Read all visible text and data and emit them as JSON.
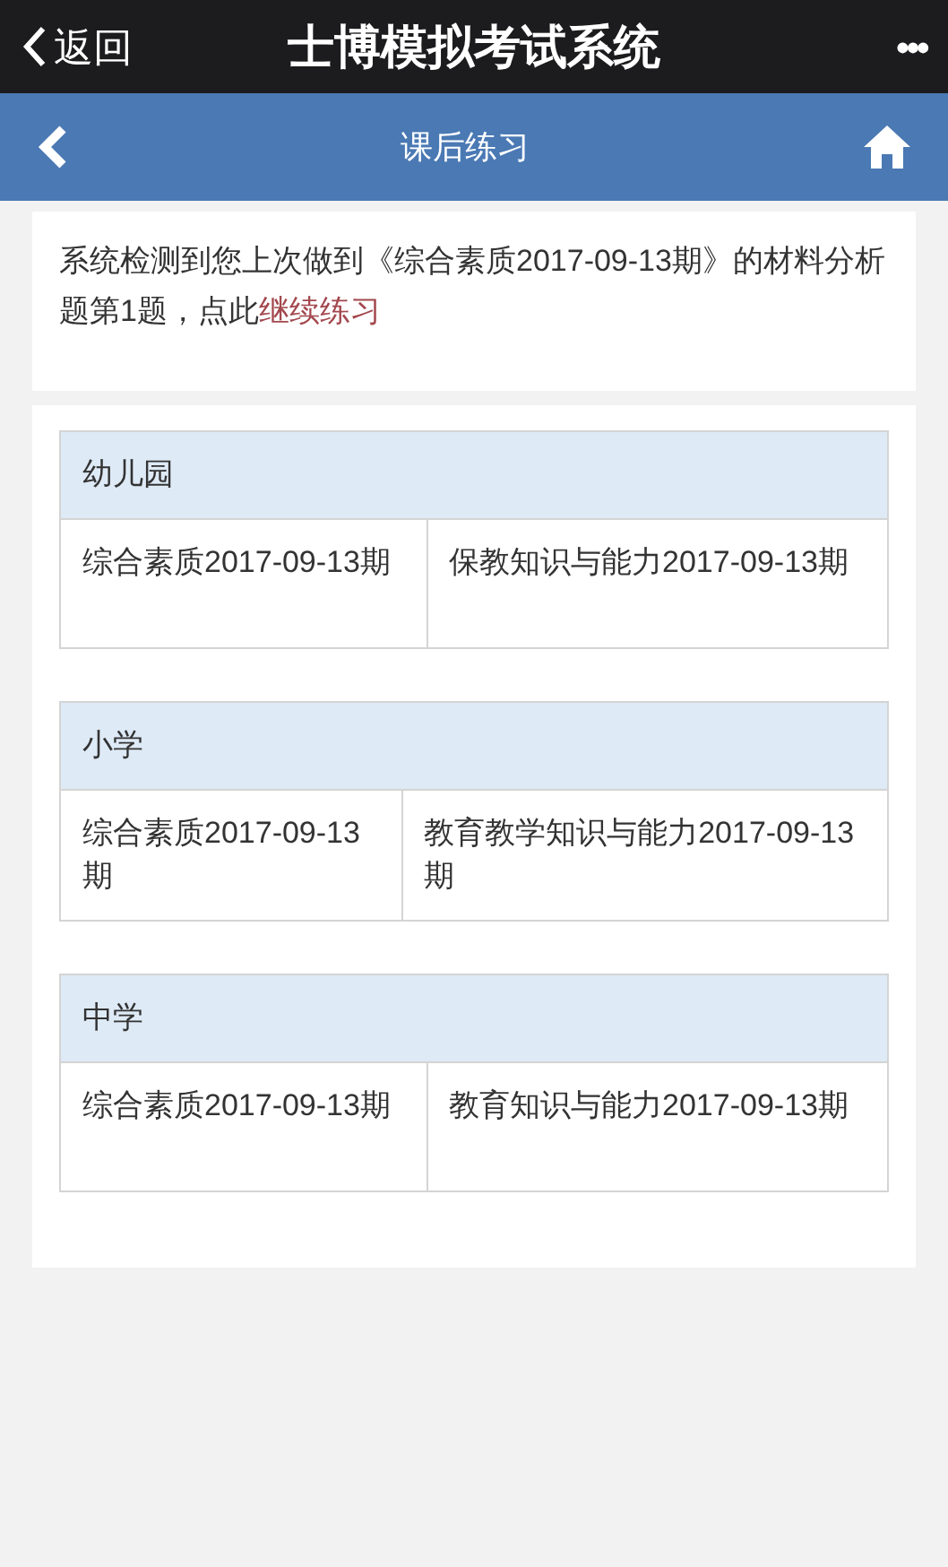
{
  "top_bar": {
    "back": "返回",
    "title": "士博模拟考试系统",
    "more": "•••"
  },
  "nav_bar": {
    "title": "课后练习"
  },
  "notice": {
    "text": "系统检测到您上次做到《综合素质2017-09-13期》的材料分析题第1题，点此",
    "link": "继续练习"
  },
  "sections": [
    {
      "title": "幼儿园",
      "items": [
        "综合素质2017-09-13期",
        "保教知识与能力2017-09-13期"
      ]
    },
    {
      "title": "小学",
      "items": [
        "综合素质2017-09-13期",
        "教育教学知识与能力2017-09-13期"
      ]
    },
    {
      "title": "中学",
      "items": [
        "综合素质2017-09-13期",
        "教育知识与能力2017-09-13期"
      ]
    }
  ]
}
